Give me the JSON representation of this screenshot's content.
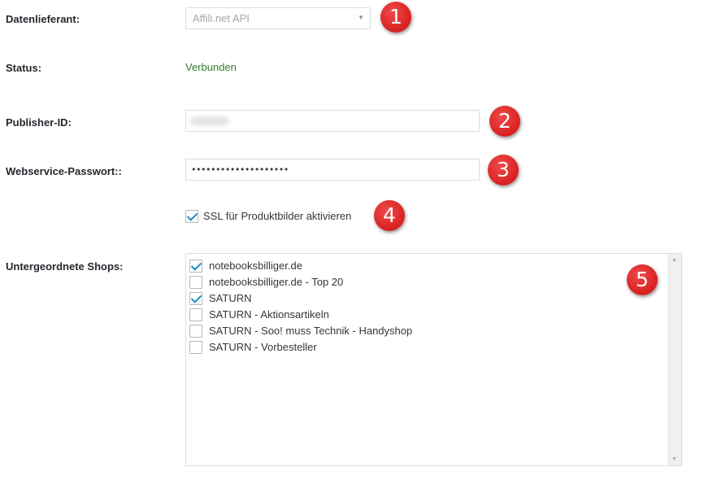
{
  "labels": {
    "data_provider": "Datenlieferant:",
    "status": "Status:",
    "publisher_id": "Publisher-ID:",
    "webservice_password": "Webservice-Passwort::",
    "sub_shops": "Untergeordnete Shops:"
  },
  "data_provider_select": {
    "selected": "Affili.net API"
  },
  "status_value": "Verbunden",
  "status_color": "#2e7d32",
  "password_value": "••••••••••••••••••••",
  "ssl": {
    "label": "SSL für Produktbilder aktivieren",
    "checked": true
  },
  "shops": [
    {
      "label": "notebooksbilliger.de",
      "checked": true
    },
    {
      "label": "notebooksbilliger.de - Top 20",
      "checked": false
    },
    {
      "label": "SATURN",
      "checked": true
    },
    {
      "label": "SATURN - Aktionsartikeln",
      "checked": false
    },
    {
      "label": "SATURN - Soo! muss Technik - Handyshop",
      "checked": false
    },
    {
      "label": "SATURN - Vorbesteller",
      "checked": false
    }
  ],
  "badges": [
    "1",
    "2",
    "3",
    "4",
    "5"
  ],
  "badge_color": "#e02a2a",
  "checkmark_color": "#1e8cbe"
}
